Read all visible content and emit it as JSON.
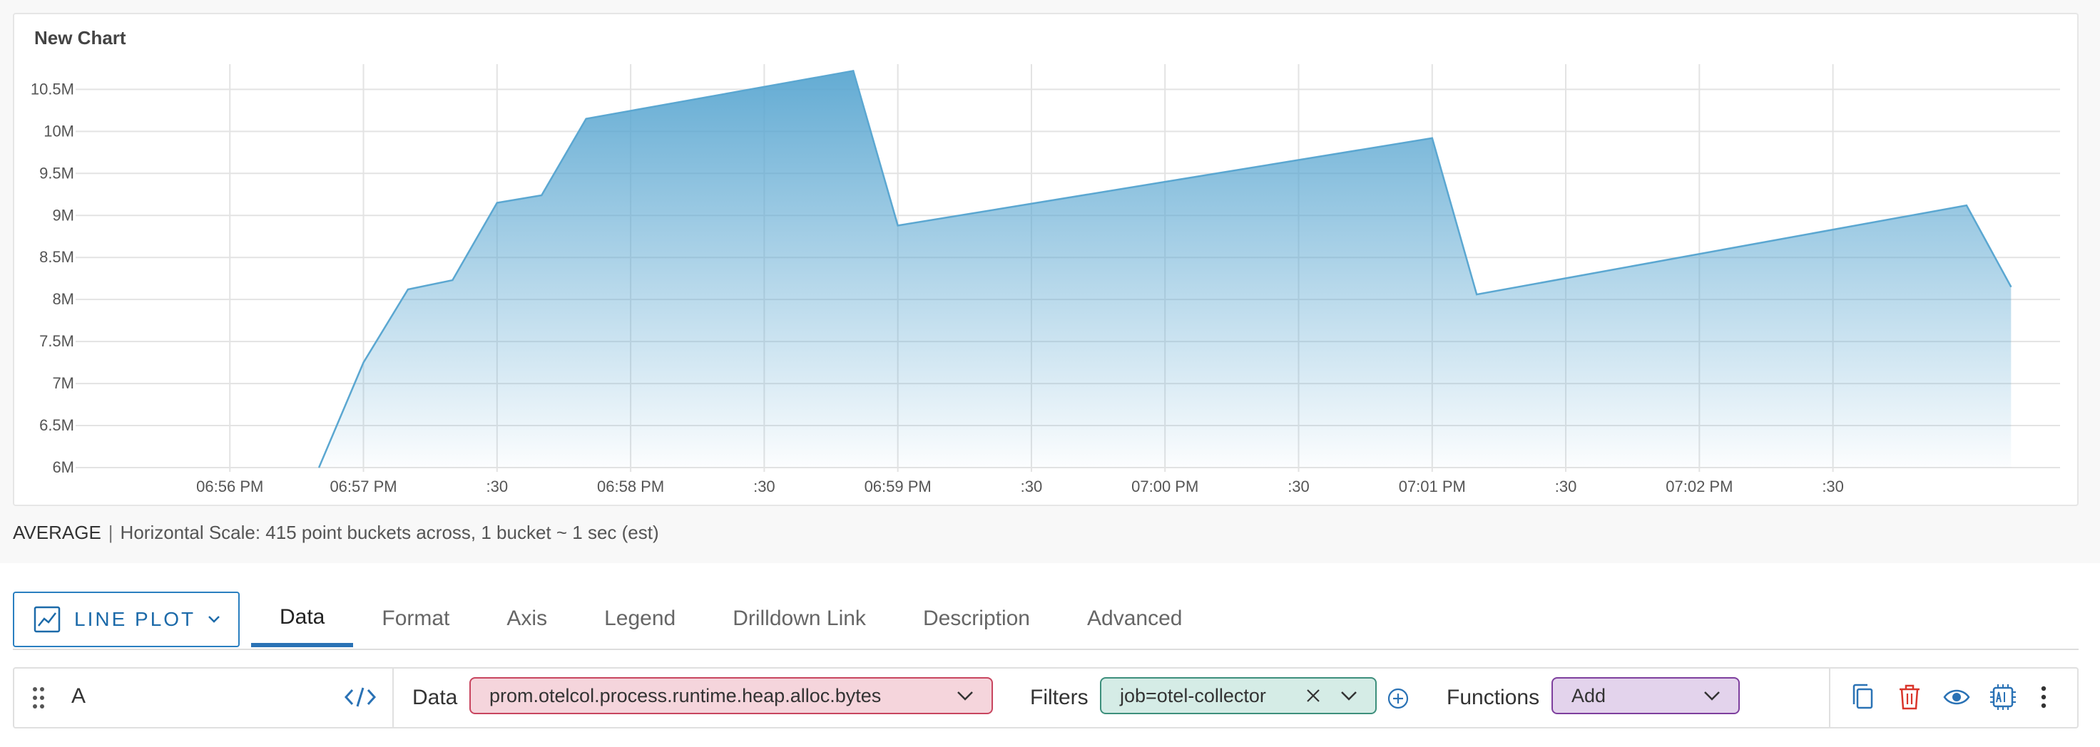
{
  "chart": {
    "title": "New Chart",
    "footer": {
      "aggregation": "AVERAGE",
      "separator": "|",
      "scale_text": "Horizontal Scale: 415 point buckets across, 1 bucket ~ 1 sec (est)"
    }
  },
  "chart_data": {
    "type": "area",
    "title": "New Chart",
    "xlabel": "",
    "ylabel": "",
    "x_ticks": [
      "06:56 PM",
      "06:57 PM",
      ":30",
      "06:58 PM",
      ":30",
      "06:59 PM",
      ":30",
      "07:00 PM",
      ":30",
      "07:01 PM",
      ":30",
      "07:02 PM",
      ":30"
    ],
    "y_ticks": [
      "6M",
      "6.5M",
      "7M",
      "7.5M",
      "8M",
      "8.5M",
      "9M",
      "9.5M",
      "10M",
      "10.5M"
    ],
    "ylim": [
      6000000,
      10800000
    ],
    "xlim_seconds_after_0656pm": [
      -34,
      411
    ],
    "grid": true,
    "series": [
      {
        "color": "#5ba7d1",
        "points": [
          {
            "t_seconds_after_0656pm": 20,
            "value": 6000000
          },
          {
            "t_seconds_after_0656pm": 30,
            "value": 7250000
          },
          {
            "t_seconds_after_0656pm": 40,
            "value": 8120000
          },
          {
            "t_seconds_after_0656pm": 50,
            "value": 8230000
          },
          {
            "t_seconds_after_0656pm": 60,
            "value": 9150000
          },
          {
            "t_seconds_after_0656pm": 70,
            "value": 9240000
          },
          {
            "t_seconds_after_0656pm": 80,
            "value": 10150000
          },
          {
            "t_seconds_after_0656pm": 140,
            "value": 10720000
          },
          {
            "t_seconds_after_0656pm": 150,
            "value": 8880000
          },
          {
            "t_seconds_after_0656pm": 270,
            "value": 9920000
          },
          {
            "t_seconds_after_0656pm": 280,
            "value": 8060000
          },
          {
            "t_seconds_after_0656pm": 390,
            "value": 9120000
          },
          {
            "t_seconds_after_0656pm": 400,
            "value": 8150000
          }
        ]
      }
    ]
  },
  "editor": {
    "plot_type_label": "LINE PLOT",
    "tabs": [
      {
        "label": "Data",
        "active": true
      },
      {
        "label": "Format",
        "active": false
      },
      {
        "label": "Axis",
        "active": false
      },
      {
        "label": "Legend",
        "active": false
      },
      {
        "label": "Drilldown Link",
        "active": false
      },
      {
        "label": "Description",
        "active": false
      },
      {
        "label": "Advanced",
        "active": false
      }
    ],
    "query": {
      "label": "A",
      "data_label": "Data",
      "metric": "prom.otelcol.process.runtime.heap.alloc.bytes",
      "filters_label": "Filters",
      "filter_value": "job=otel-collector",
      "functions_label": "Functions",
      "functions_value": "Add"
    }
  },
  "icons": {
    "plot_type": "line-chart-icon",
    "drag": "drag-handle-icon",
    "code": "code-icon",
    "remove": "close-icon",
    "add": "plus-circle-icon",
    "copy": "copy-icon",
    "delete": "trash-icon",
    "visibility": "eye-icon",
    "ai": "ai-chip-icon",
    "more": "kebab-icon"
  },
  "colors": {
    "series": "#5ba7d1",
    "accent": "#2a72b5",
    "data_pill": "#f5d5dc",
    "filter_pill": "#d5ece6",
    "functions_pill": "#e3d3ec",
    "delete": "#d9352b"
  }
}
